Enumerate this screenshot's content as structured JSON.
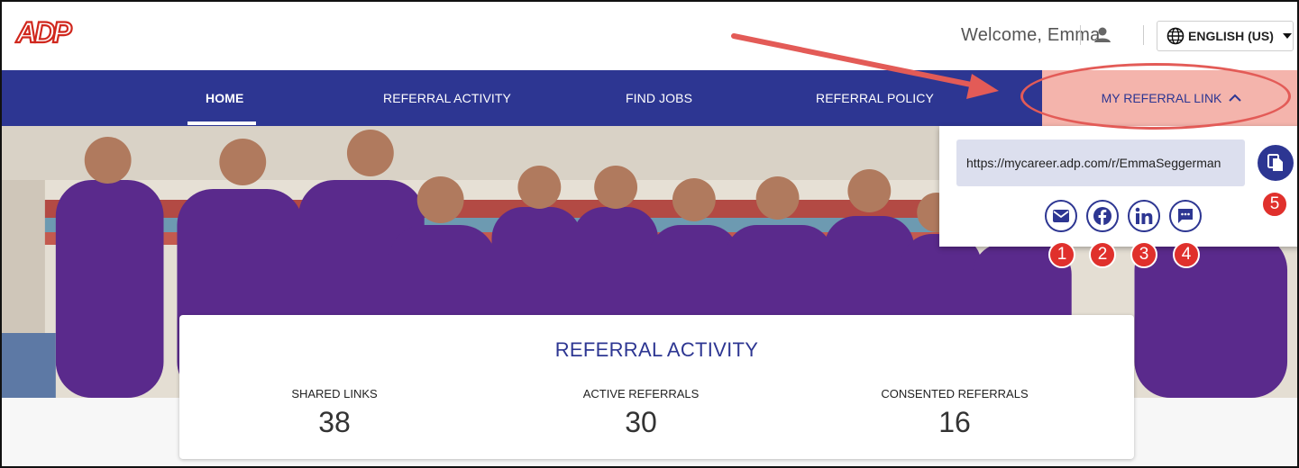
{
  "header": {
    "logo_text": "ADP",
    "welcome_text": "Welcome, Emma",
    "language_label": "ENGLISH (US)"
  },
  "nav": {
    "items": [
      {
        "label": "HOME",
        "active": true
      },
      {
        "label": "REFERRAL ACTIVITY"
      },
      {
        "label": "FIND JOBS"
      },
      {
        "label": "REFERRAL POLICY"
      },
      {
        "label": "MY REFERRAL LINK"
      }
    ]
  },
  "referral_panel": {
    "url": "https://mycareer.adp.com/r/EmmaSeggerman",
    "share_icons": [
      "email-icon",
      "facebook-icon",
      "linkedin-icon",
      "message-icon"
    ],
    "copy_icon": "copy-icon"
  },
  "callouts": [
    "1",
    "2",
    "3",
    "4",
    "5"
  ],
  "activity": {
    "title": "REFERRAL ACTIVITY",
    "stats": [
      {
        "label": "SHARED LINKS",
        "value": "38"
      },
      {
        "label": "ACTIVE REFERRALS",
        "value": "30"
      },
      {
        "label": "CONSENTED REFERRALS",
        "value": "16"
      }
    ]
  },
  "colors": {
    "brand_blue": "#2d3692",
    "highlight": "#f4b4ac",
    "callout_red": "#e0302c",
    "adp_red": "#d0271d"
  }
}
